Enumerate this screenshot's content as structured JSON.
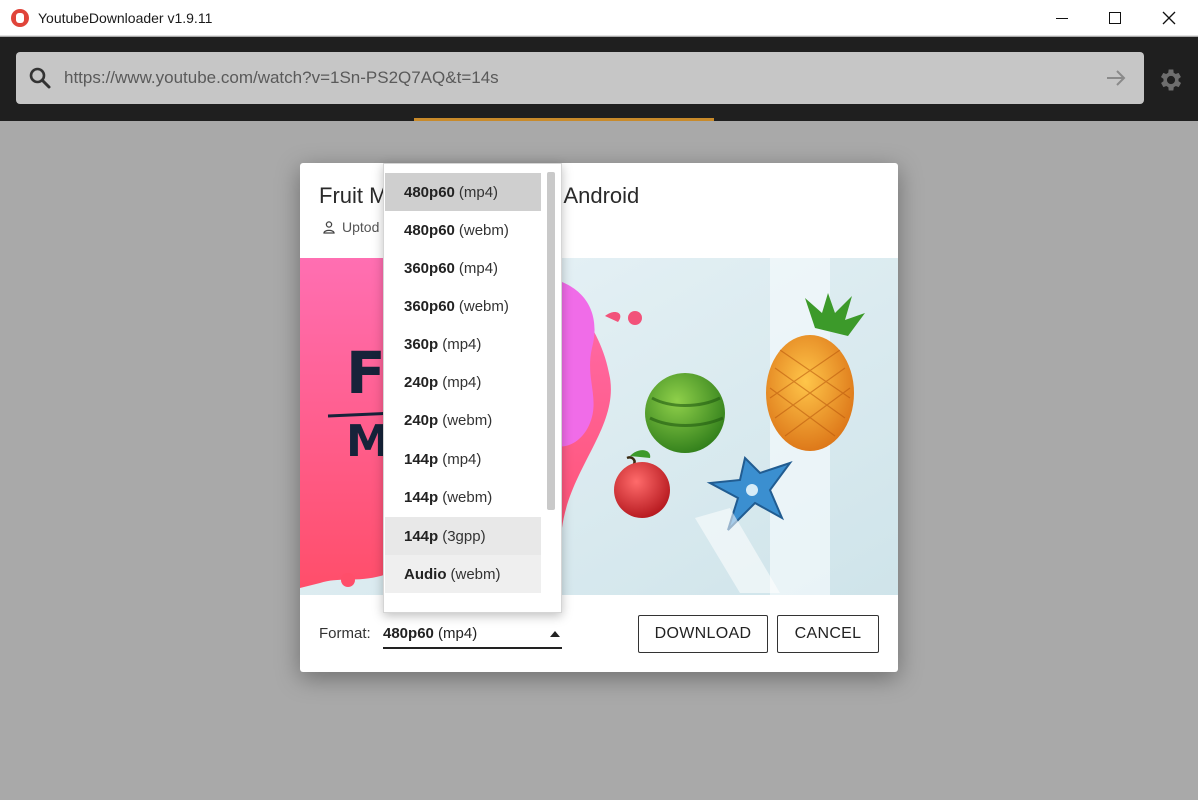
{
  "window": {
    "title": "YoutubeDownloader v1.9.11"
  },
  "search": {
    "url": "https://www.youtube.com/watch?v=1Sn-PS2Q7AQ&t=14s"
  },
  "dialog": {
    "title_prefix": "Fruit M",
    "title_suffix": "Android",
    "uploader": "Uptod",
    "format_label": "Format:",
    "format_selected_bold": "480p60",
    "format_selected_rest": "(mp4)",
    "download_label": "DOWNLOAD",
    "cancel_label": "CANCEL"
  },
  "formats": [
    {
      "quality": "480p60",
      "container": "(mp4)"
    },
    {
      "quality": "480p60",
      "container": "(webm)"
    },
    {
      "quality": "360p60",
      "container": "(mp4)"
    },
    {
      "quality": "360p60",
      "container": "(webm)"
    },
    {
      "quality": "360p",
      "container": "(mp4)"
    },
    {
      "quality": "240p",
      "container": "(mp4)"
    },
    {
      "quality": "240p",
      "container": "(webm)"
    },
    {
      "quality": "144p",
      "container": "(mp4)"
    },
    {
      "quality": "144p",
      "container": "(webm)"
    },
    {
      "quality": "144p",
      "container": "(3gpp)"
    },
    {
      "quality": "Audio",
      "container": "(webm)"
    }
  ],
  "thumbnail_text": {
    "line1": "FI",
    "line2": "M"
  },
  "colors": {
    "accent": "#c88a2a",
    "app_icon": "#e0443a",
    "toolbar": "#1f1f1f",
    "overlay": "#a9a9a9"
  }
}
